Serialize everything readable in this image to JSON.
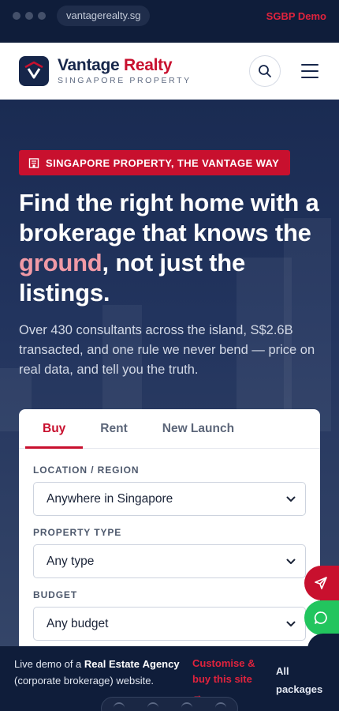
{
  "browser": {
    "url": "vantagerealty.sg",
    "demo_tag": "SGBP Demo"
  },
  "header": {
    "brand_name_primary": "Vantage",
    "brand_name_accent": "Realty",
    "brand_tagline": "SINGAPORE PROPERTY",
    "icons": [
      "logo-mark",
      "search-icon",
      "hamburger-menu-icon"
    ]
  },
  "hero": {
    "badge": "SINGAPORE PROPERTY, THE VANTAGE WAY",
    "headline_before": "Find the right home with a brokerage that knows the ",
    "headline_highlight": "ground",
    "headline_after": ", not just the listings.",
    "lede": "Over 430 consultants across the island, S$2.6B transacted, and one rule we never bend — price on real data, and tell you the truth."
  },
  "search": {
    "tabs": [
      {
        "label": "Buy",
        "active": true
      },
      {
        "label": "Rent",
        "active": false
      },
      {
        "label": "New Launch",
        "active": false
      }
    ],
    "fields": [
      {
        "label": "LOCATION / REGION",
        "value": "Anywhere in Singapore"
      },
      {
        "label": "PROPERTY TYPE",
        "value": "Any type"
      },
      {
        "label": "BUDGET",
        "value": "Any budget"
      }
    ]
  },
  "fabs": {
    "send": "send-icon",
    "chat": "whatsapp-icon"
  },
  "demo_bar": {
    "text_prefix": "Live demo of a ",
    "text_bold1": "Real Estate",
    "text_bold2": "Agency",
    "text_suffix": " (corporate brokerage) website.",
    "cta": "Customise & buy this site →",
    "all_packages": "All packages"
  },
  "colors": {
    "brand_navy": "#16264a",
    "brand_red": "#c8102e",
    "highlight_pink": "#f19aa6",
    "chat_green": "#22c55e"
  }
}
